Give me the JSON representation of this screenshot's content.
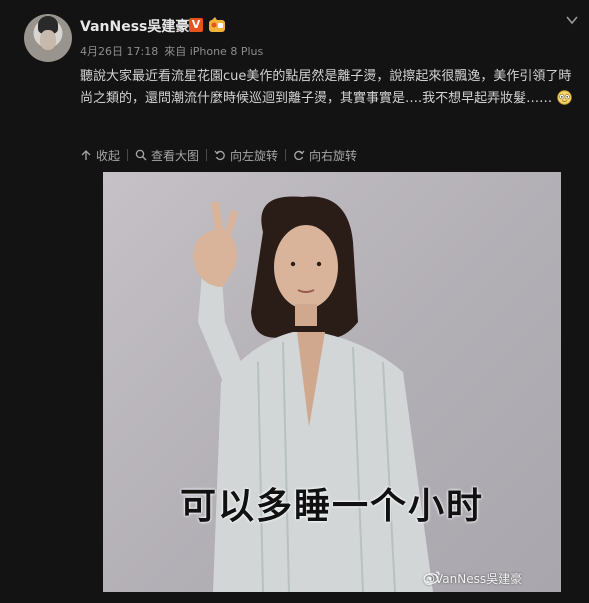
{
  "post": {
    "username": "VanNess吳建豪",
    "verified_badge": "V",
    "date": "4月26日 17:18",
    "source": "來自 iPhone 8 Plus",
    "text": "聽說大家最近看流星花園cue美作的點居然是離子燙，說擦起來很飄逸，美作引領了時尚之類的，還問潮流什麼時候巡迴到離子燙，其實事實是….我不想早起弄妝髮……",
    "emoji": "laughing-tears-emoji"
  },
  "actions": {
    "collect": "收起",
    "view_large": "查看大图",
    "rotate_left": "向左旋转",
    "rotate_right": "向右旋转"
  },
  "photo": {
    "caption": "可以多睡一个小时",
    "watermark": "@VanNess吳建豪"
  },
  "colors": {
    "background": "#131313",
    "badge": "#e8541e",
    "text": "#d3d3d3",
    "meta": "#8d8d8d"
  }
}
